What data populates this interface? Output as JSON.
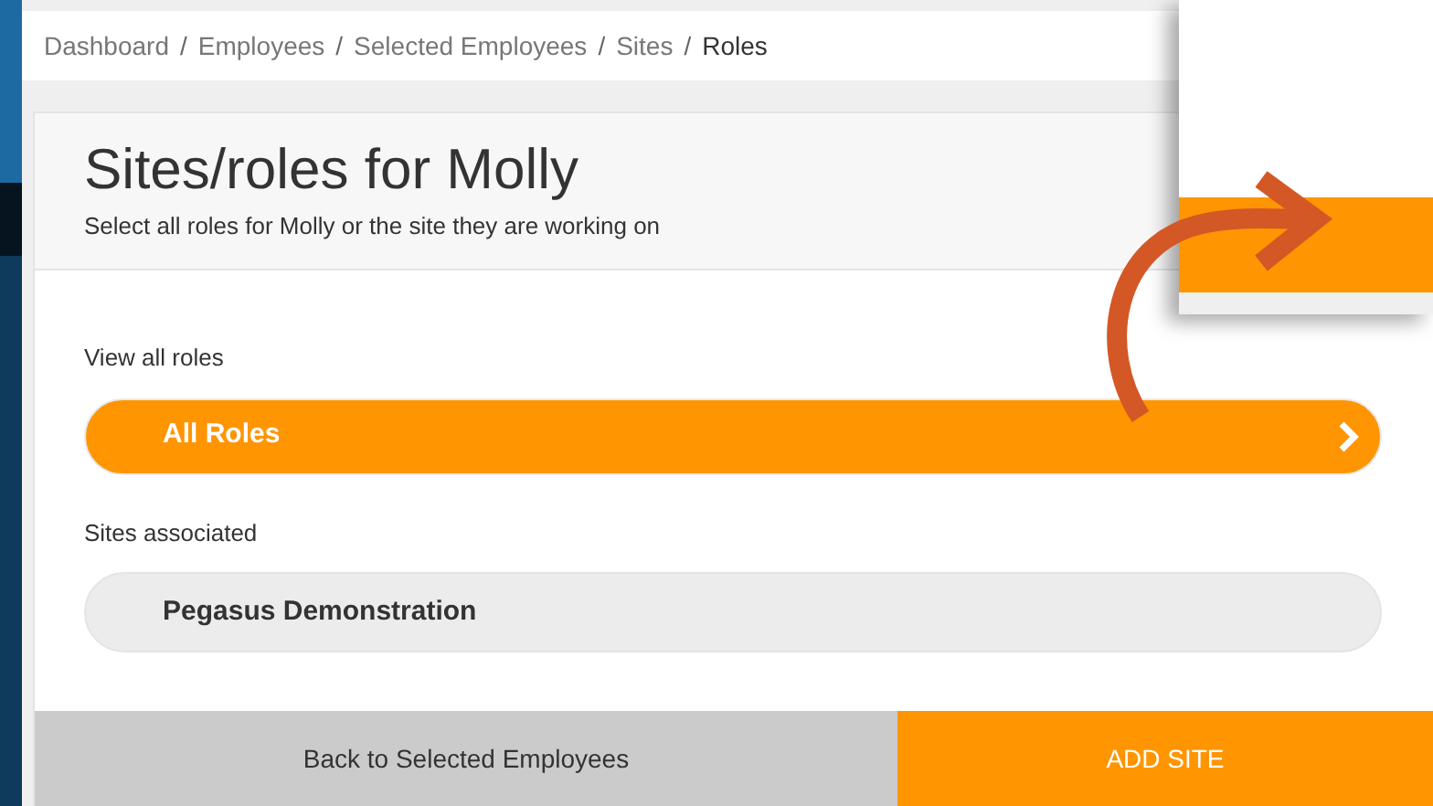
{
  "breadcrumb": [
    {
      "label": "Dashboard",
      "current": false
    },
    {
      "separator": "/",
      "label": "Employees",
      "current": false
    },
    {
      "separator": "/",
      "label": "Selected Employees",
      "current": false
    },
    {
      "separator": "/",
      "label": "Sites",
      "current": false
    },
    {
      "separator": "/",
      "label": "Roles",
      "current": true
    }
  ],
  "header": {
    "title": "Sites/roles for Molly",
    "subtitle": "Select all roles for Molly or the site they are working on"
  },
  "roles_section": {
    "label": "View all roles",
    "button": "All Roles"
  },
  "sites_section": {
    "label": "Sites associated",
    "sites": [
      "Pegasus Demonstration"
    ]
  },
  "footer_buttons": [
    {
      "label": "Back to Selected Employees",
      "kind": "secondary"
    },
    {
      "label": "ADD SITE",
      "kind": "primary"
    }
  ]
}
